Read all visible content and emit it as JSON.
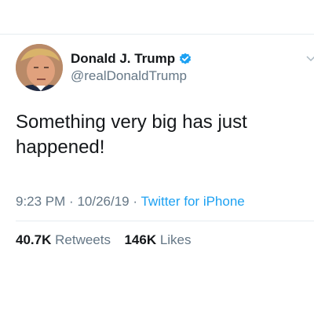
{
  "user": {
    "name": "Donald J. Trump",
    "handle": "@realDonaldTrump",
    "avatar_icon": "profile-photo",
    "verified_icon": "verified-badge-icon"
  },
  "tweet": {
    "text": "Something very big has just happened!",
    "time": "9:23 PM",
    "date": "10/26/19",
    "separator": "·",
    "source": "Twitter for iPhone"
  },
  "stats": {
    "retweets_count": "40.7K",
    "retweets_label": "Retweets",
    "likes_count": "146K",
    "likes_label": "Likes"
  },
  "colors": {
    "accent": "#1da1f2",
    "secondary_text": "#657786",
    "primary_text": "#14171a",
    "divider": "#e6ecf0"
  }
}
